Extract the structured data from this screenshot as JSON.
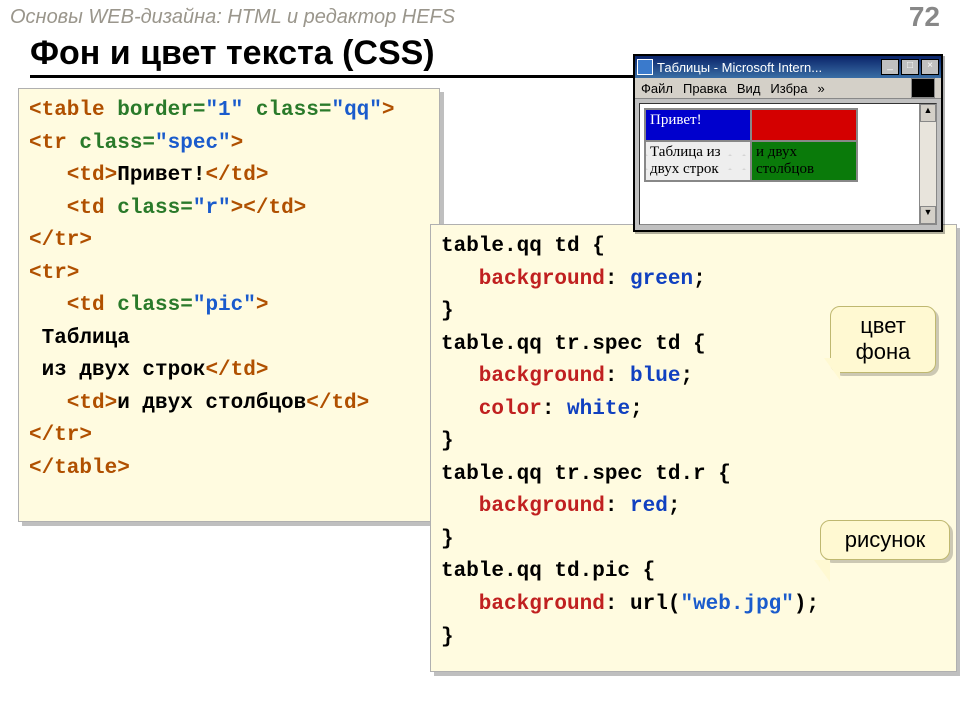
{
  "header": {
    "subtitle": "Основы WEB-дизайна: HTML и редактор HEFS",
    "page_number": "72"
  },
  "title": "Фон и цвет текста (CSS)",
  "html_code": {
    "l1_open": "<table ",
    "l1_attr": "border=",
    "l1_v1": "\"1\"",
    "l1_attr2": " class=",
    "l1_v2": "\"qq\"",
    "l1_close": ">",
    "l2_open": "<tr ",
    "l2_attr": "class=",
    "l2_v": "\"spec\"",
    "l2_close": ">",
    "l3_open": "   <td>",
    "l3_text": "Привет!",
    "l3_close": "</td>",
    "l4_open": "   <td ",
    "l4_attr": "class=",
    "l4_v": "\"r\"",
    "l4_close": "></td>",
    "l5": "</tr>",
    "l6": "<tr>",
    "l7_open": "   <td ",
    "l7_attr": "class=",
    "l7_v": "\"pic\"",
    "l7_close": ">",
    "l8": " Таблица",
    "l9a": " из двух строк",
    "l9b": "</td>",
    "l10_open": "   <td>",
    "l10_text": "и двух столбцов",
    "l10_close": "</td>",
    "l11": "</tr>",
    "l12": "</table>"
  },
  "css_code": {
    "s1": "table.qq td {",
    "p1": "   background",
    "c1": ": ",
    "v1": "green",
    "e": ";",
    "rb": "}",
    "s2": "table.qq tr.spec td {",
    "p2": "   background",
    "v2": "blue",
    "p3": "   color",
    "v3": "white",
    "s3": "table.qq tr.spec td.r {",
    "v4": "red",
    "s4": "table.qq td.pic {",
    "u1": "url(",
    "u2": "\"web.jpg\"",
    "u3": ")"
  },
  "callouts": {
    "c1": "цвет\nфона",
    "c2": "рисунок"
  },
  "browser": {
    "title": "Таблицы - Microsoft Intern...",
    "menu": {
      "file": "Файл",
      "edit": "Правка",
      "view": "Вид",
      "fav": "Избра",
      "more": "»"
    },
    "cells": {
      "r1c1": "Привет!",
      "r1c2": "",
      "r2c1": "Таблица из двух строк",
      "r2c2": "и двух столбцов"
    },
    "winbtns": {
      "min": "_",
      "max": "□",
      "close": "×"
    }
  }
}
